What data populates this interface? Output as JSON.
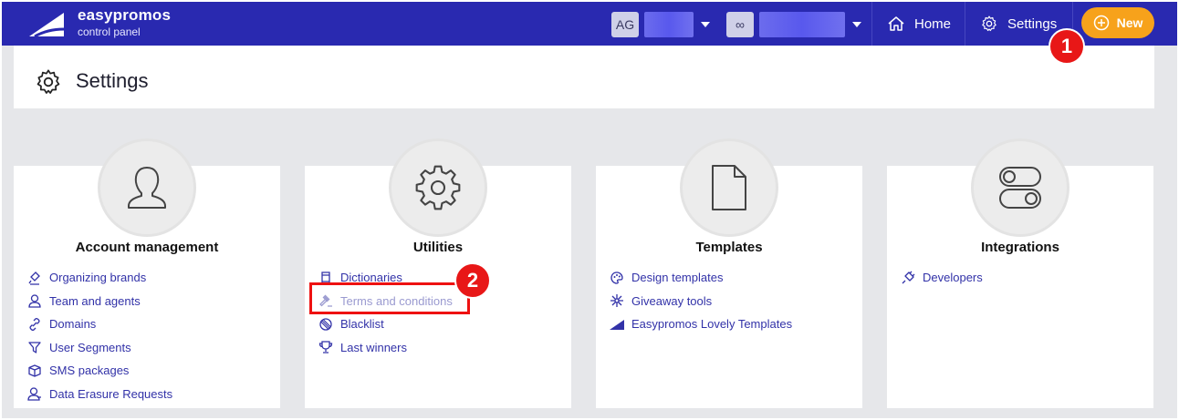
{
  "header": {
    "brand_name": "easypromos",
    "brand_sub": "control panel",
    "user_initials": "AG",
    "workspace_symbol": "∞",
    "home_label": "Home",
    "settings_label": "Settings",
    "new_label": "New",
    "colors": {
      "topbar": "#2929b0",
      "new_button": "#f7a21b"
    }
  },
  "page": {
    "title": "Settings"
  },
  "callouts": {
    "one": "1",
    "two": "2",
    "color": "#e81717"
  },
  "cards": [
    {
      "title": "Account management",
      "icon": "user-icon",
      "links": [
        {
          "label": "Organizing brands",
          "icon": "brand-stamp-icon"
        },
        {
          "label": "Team and agents",
          "icon": "user-outline-icon"
        },
        {
          "label": "Domains",
          "icon": "link-icon"
        },
        {
          "label": "User Segments",
          "icon": "filter-icon"
        },
        {
          "label": "SMS packages",
          "icon": "package-icon"
        },
        {
          "label": "Data Erasure Requests",
          "icon": "user-erase-icon"
        }
      ]
    },
    {
      "title": "Utilities",
      "icon": "gear-icon",
      "links": [
        {
          "label": "Dictionaries",
          "icon": "book-icon"
        },
        {
          "label": "Terms and conditions",
          "icon": "gavel-icon"
        },
        {
          "label": "Blacklist",
          "icon": "ban-icon"
        },
        {
          "label": "Last winners",
          "icon": "trophy-icon"
        }
      ]
    },
    {
      "title": "Templates",
      "icon": "document-icon",
      "links": [
        {
          "label": "Design templates",
          "icon": "palette-icon"
        },
        {
          "label": "Giveaway tools",
          "icon": "sparkle-icon"
        },
        {
          "label": "Easypromos Lovely Templates",
          "icon": "easypromos-logo-icon"
        }
      ]
    },
    {
      "title": "Integrations",
      "icon": "toggle-icon",
      "links": [
        {
          "label": "Developers",
          "icon": "plug-icon"
        }
      ]
    }
  ]
}
